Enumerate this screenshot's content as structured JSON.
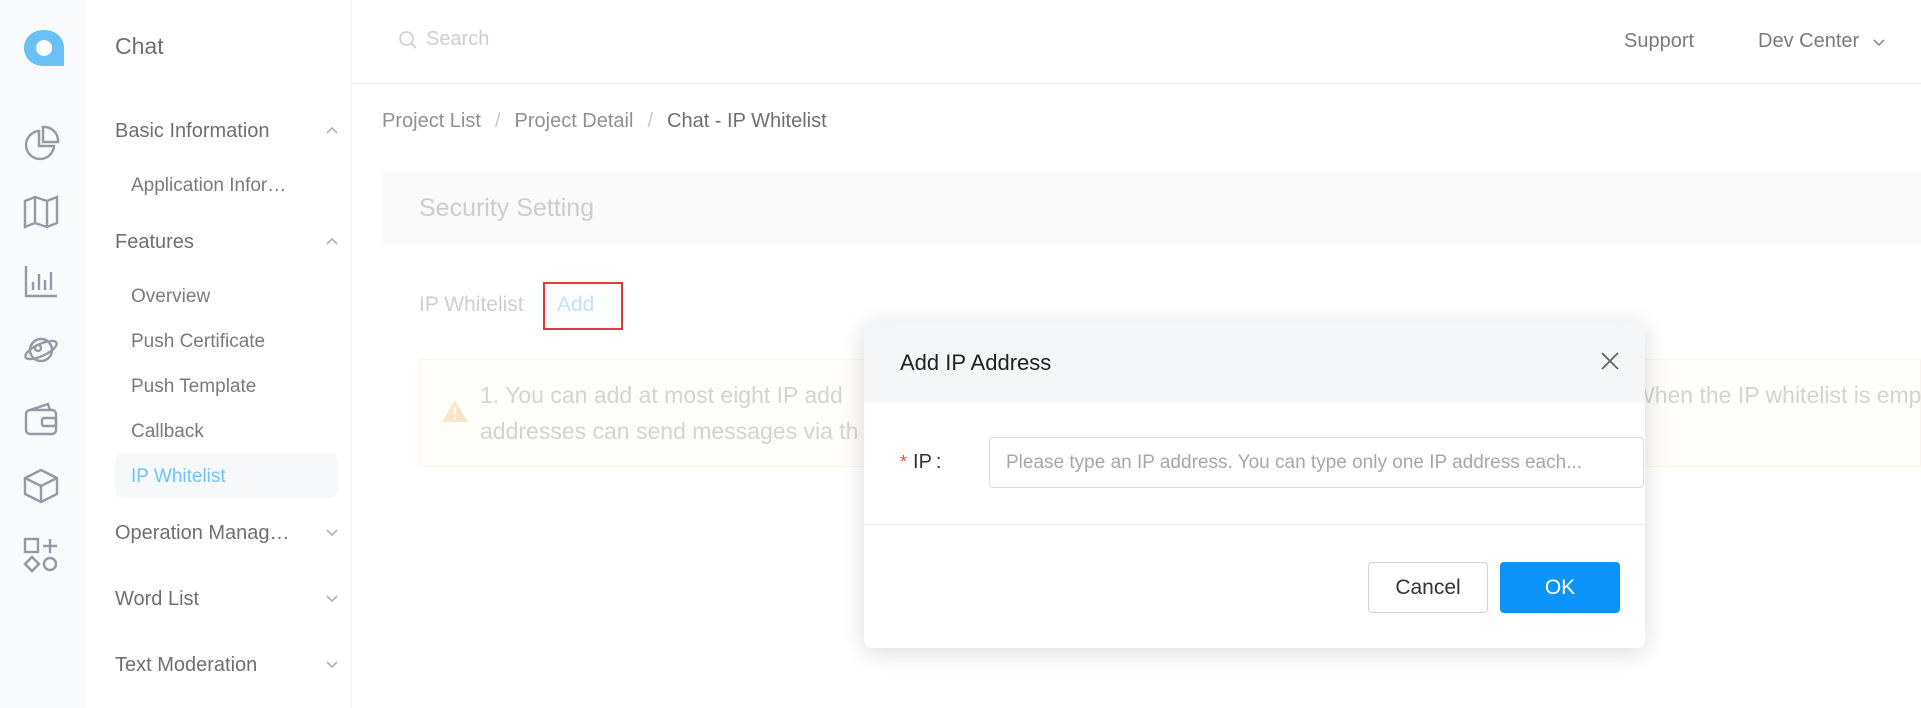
{
  "app": {
    "title": "Chat"
  },
  "rail": {
    "icons": [
      "logo-icon",
      "dashboard-icon",
      "map-icon",
      "chart-icon",
      "planet-icon",
      "wallet-icon",
      "package-icon",
      "shapes-icon"
    ]
  },
  "menu": {
    "groups": [
      {
        "label": "Basic Information",
        "expanded": true,
        "items": [
          "Application Infor…"
        ]
      },
      {
        "label": "Features",
        "expanded": true,
        "items": [
          "Overview",
          "Push Certificate",
          "Push Template",
          "Callback",
          "IP Whitelist"
        ]
      },
      {
        "label": "Operation Manag…",
        "expanded": false,
        "items": []
      },
      {
        "label": "Word List",
        "expanded": false,
        "items": []
      },
      {
        "label": "Text Moderation",
        "expanded": false,
        "items": []
      }
    ],
    "active_item": "IP Whitelist"
  },
  "topbar": {
    "search_placeholder": "Search",
    "support": "Support",
    "dev_center": "Dev Center"
  },
  "breadcrumb": {
    "items": [
      "Project List",
      "Project Detail",
      "Chat - IP Whitelist"
    ],
    "separator": "/"
  },
  "page": {
    "section_title": "Security Setting",
    "whitelist_label": "IP Whitelist",
    "add_link": "Add",
    "notice_line_1": "1. You can add at most eight IP add",
    "notice_line_1_right": "When the IP whitelist is emp",
    "notice_line_2": "addresses can send messages via th"
  },
  "modal": {
    "title": "Add IP Address",
    "ip_label": "IP",
    "ip_colon": ":",
    "required_mark": "*",
    "ip_placeholder": "Please type an IP address. You can type only one IP address each...",
    "ip_value": "",
    "cancel": "Cancel",
    "ok": "OK"
  },
  "colors": {
    "accent": "#1fa6ff",
    "primary_button": "#0d94fb",
    "highlight_box": "#e03a3a",
    "required": "#f04d4d"
  }
}
